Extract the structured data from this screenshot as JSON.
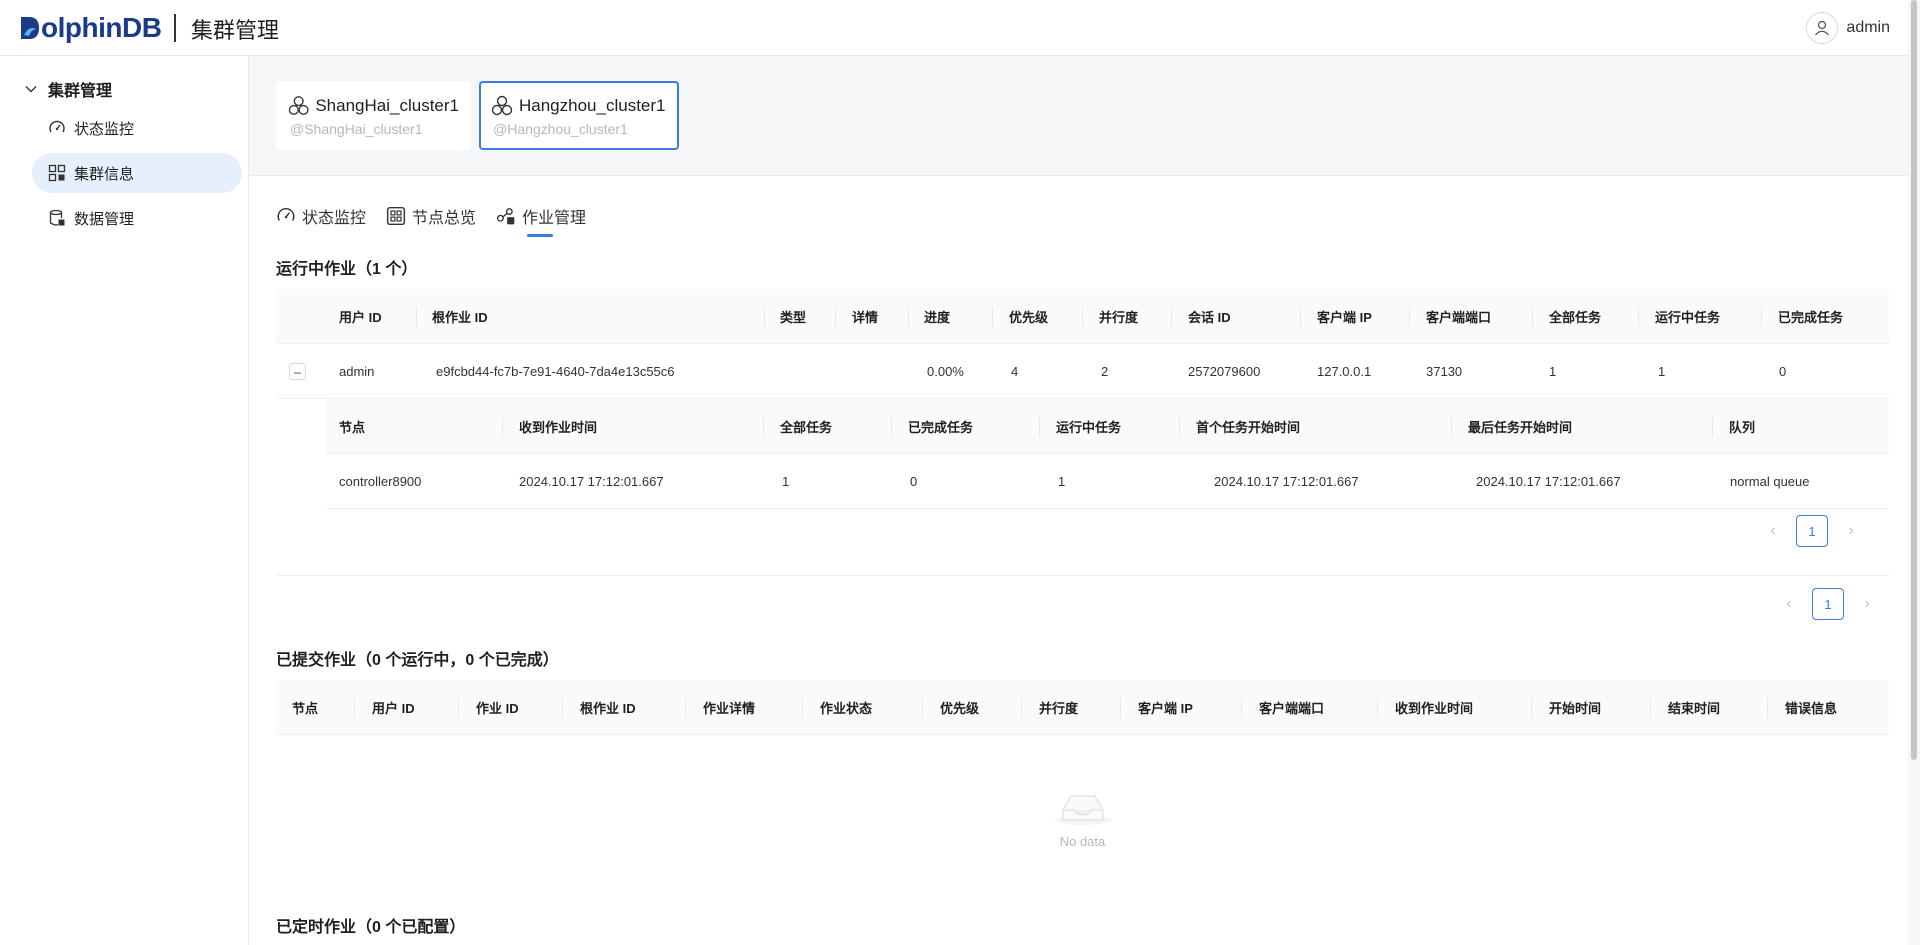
{
  "header": {
    "logo_text": "olphinDB",
    "app_title": "集群管理",
    "user_name": "admin",
    "brand_color": "#1c3a8a"
  },
  "sidebar": {
    "group_label": "集群管理",
    "items": [
      {
        "label": "状态监控",
        "icon": "gauge-icon"
      },
      {
        "label": "集群信息",
        "icon": "cluster-info-icon",
        "active": true
      },
      {
        "label": "数据管理",
        "icon": "database-icon"
      }
    ]
  },
  "clusters": [
    {
      "name": "ShangHai_cluster1",
      "sub": "@ShangHai_cluster1"
    },
    {
      "name": "Hangzhou_cluster1",
      "sub": "@Hangzhou_cluster1",
      "active": true
    }
  ],
  "tabs": [
    {
      "label": "状态监控",
      "icon": "gauge-icon"
    },
    {
      "label": "节点总览",
      "icon": "grid-icon"
    },
    {
      "label": "作业管理",
      "icon": "jobs-icon",
      "active": true
    }
  ],
  "running": {
    "title": "运行中作业（1 个）",
    "columns": [
      "用户 ID",
      "根作业 ID",
      "类型",
      "详情",
      "进度",
      "优先级",
      "并行度",
      "会话 ID",
      "客户端 IP",
      "客户端端口",
      "全部任务",
      "运行中任务",
      "已完成任务"
    ],
    "rows": [
      [
        "admin",
        "e9fcbd44-fc7b-7e91-4640-7da4e13c55c6",
        "",
        "",
        "0.00%",
        "4",
        "2",
        "2572079600",
        "127.0.0.1",
        "37130",
        "1",
        "1",
        "0"
      ]
    ],
    "expand_symbol": "–",
    "sub_columns": [
      "节点",
      "收到作业时间",
      "全部任务",
      "已完成任务",
      "运行中任务",
      "首个任务开始时间",
      "最后任务开始时间",
      "队列"
    ],
    "sub_rows": [
      [
        "controller8900",
        "2024.10.17 17:12:01.667",
        "1",
        "0",
        "1",
        "2024.10.17 17:12:01.667",
        "2024.10.17 17:12:01.667",
        "normal queue"
      ]
    ],
    "sub_page": "1",
    "page": "1"
  },
  "submitted": {
    "title": "已提交作业（0 个运行中，0 个已完成）",
    "columns": [
      "节点",
      "用户 ID",
      "作业 ID",
      "根作业 ID",
      "作业详情",
      "作业状态",
      "优先级",
      "并行度",
      "客户端 IP",
      "客户端端口",
      "收到作业时间",
      "开始时间",
      "结束时间",
      "错误信息"
    ],
    "empty_text": "No data"
  },
  "scheduled": {
    "title": "已定时作业（0 个已配置）"
  },
  "accent_color": "#3b7ce0"
}
